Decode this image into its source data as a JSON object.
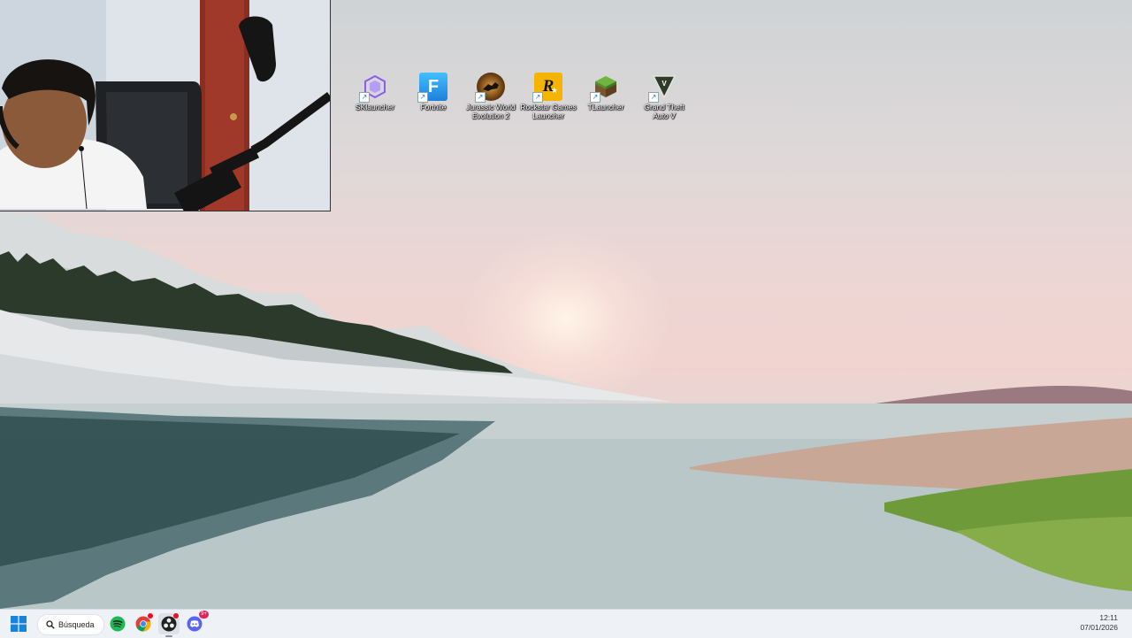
{
  "desktop": {
    "icons": [
      {
        "label": "SKlauncher",
        "icon": "sklauncher-icon",
        "color": "#8a5cf0"
      },
      {
        "label": "Fortnite",
        "icon": "fortnite-icon",
        "color": "#35a8f0"
      },
      {
        "label": "Jurassic World Evolution 2",
        "icon": "jurassic-world-icon",
        "color": "#5a3a12"
      },
      {
        "label": "Rockstar Games Launcher",
        "icon": "rockstar-icon",
        "color": "#f5b400"
      },
      {
        "label": "TLauncher",
        "icon": "tlauncher-icon",
        "color": "#5c9e3a"
      },
      {
        "label": "Grand Theft Auto V",
        "icon": "gta-v-icon",
        "color": "#2f3a2a"
      }
    ]
  },
  "webcam": {
    "description_icon": "webcam-overlay"
  },
  "taskbar": {
    "search_label": "Búsqueda",
    "apps": [
      {
        "name": "spotify",
        "icon": "spotify-icon",
        "color": "#1db954"
      },
      {
        "name": "chrome",
        "icon": "chrome-icon",
        "color": "#4285f4"
      },
      {
        "name": "obs",
        "icon": "obs-icon",
        "color": "#222222"
      },
      {
        "name": "discord",
        "icon": "discord-icon",
        "color": "#5865f2",
        "badge": "9+"
      }
    ],
    "clock": {
      "time": "12:11",
      "date": "07/01/2026"
    }
  }
}
